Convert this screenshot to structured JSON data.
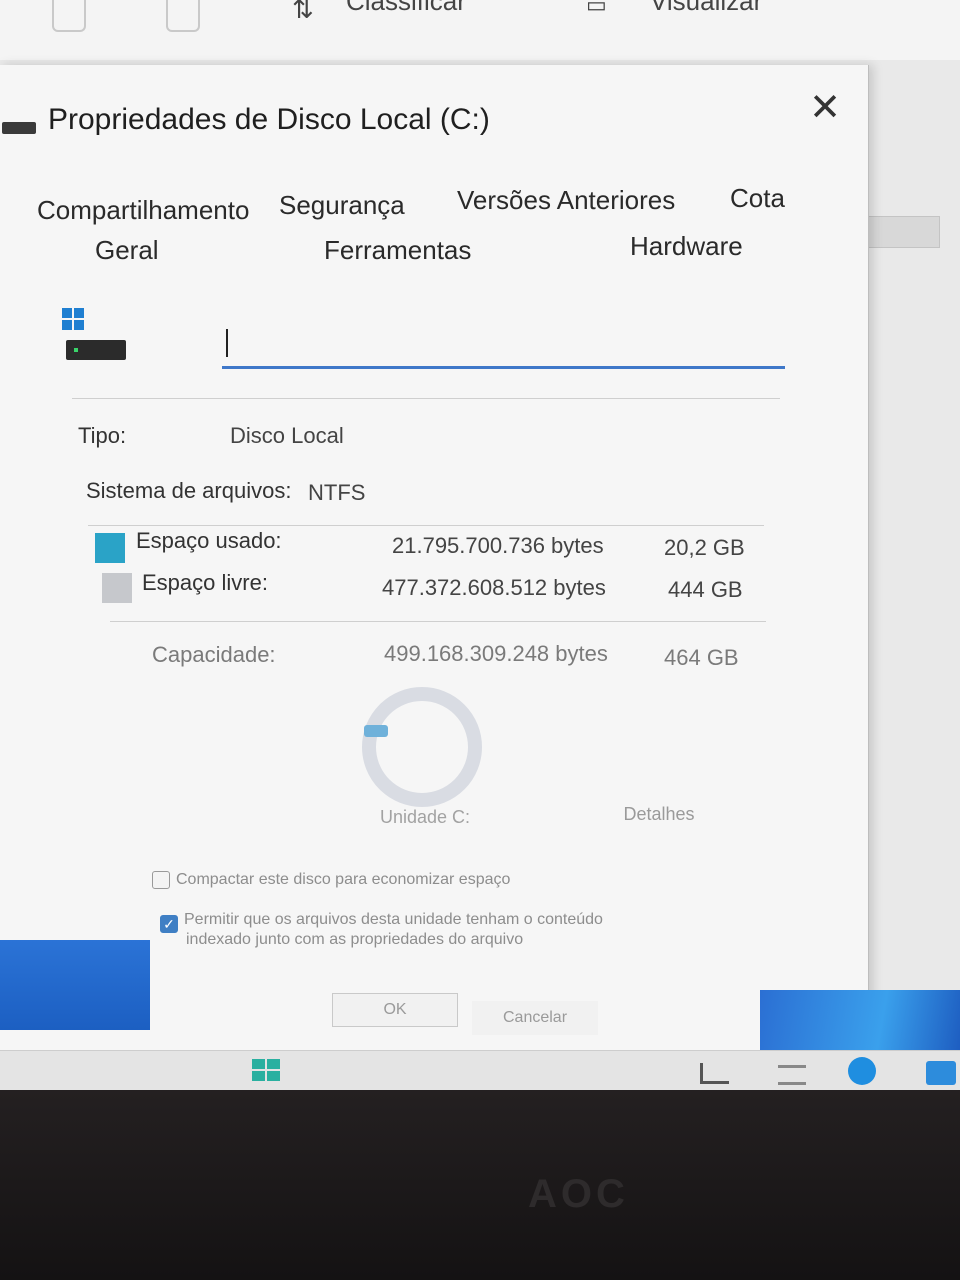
{
  "background_window": {
    "toolbar": {
      "sort_label": "Classificar",
      "view_label": "Visualizar"
    }
  },
  "dialog": {
    "title": "Propriedades de Disco Local (C:)",
    "tabs_row1": [
      "Compartilhamento",
      "Segurança",
      "Versões Anteriores",
      "Cota"
    ],
    "tabs_row2": [
      "Geral",
      "Ferramentas",
      "Hardware"
    ],
    "active_tab": "Geral",
    "drive_label_value": "",
    "type_label": "Tipo:",
    "type_value": "Disco Local",
    "fs_label": "Sistema de arquivos:",
    "fs_value": "NTFS",
    "used_label": "Espaço usado:",
    "used_bytes": "21.795.700.736 bytes",
    "used_gb": "20,2 GB",
    "free_label": "Espaço livre:",
    "free_bytes": "477.372.608.512 bytes",
    "free_gb": "444 GB",
    "capacity_label": "Capacidade:",
    "capacity_bytes": "499.168.309.248 bytes",
    "capacity_gb": "464 GB",
    "drive_caption": "Unidade C:",
    "details_button": "Detalhes",
    "compress_label": "Compactar este disco para economizar espaço",
    "compress_checked": false,
    "index_label_line1": "Permitir que os arquivos desta unidade tenham o conteúdo",
    "index_label_line2": "indexado junto com as propriedades do arquivo",
    "index_checked": true,
    "ok_button": "OK",
    "cancel_button": "Cancelar",
    "used_fraction": 0.044,
    "colors": {
      "used": "#2aa3c7",
      "free": "#c6c8cc",
      "accent": "#3f78c9"
    }
  },
  "monitor": {
    "brand": "AOC"
  }
}
